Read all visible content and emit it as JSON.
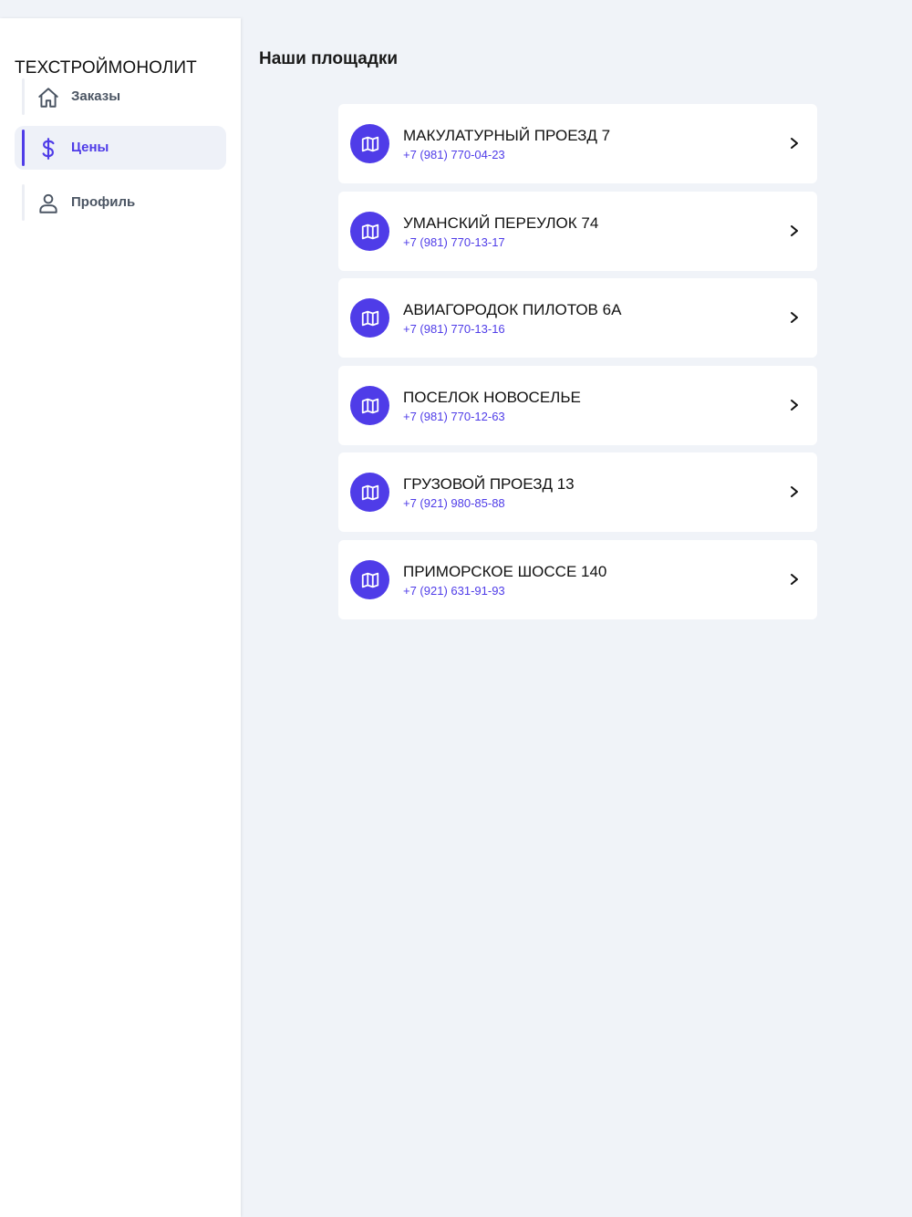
{
  "sidebar": {
    "brand": "ТЕХСТРОЙМОНОЛИТ",
    "items": [
      {
        "label": "Заказы",
        "icon": "home-icon",
        "active": false
      },
      {
        "label": "Цены",
        "icon": "dollar-icon",
        "active": true
      },
      {
        "label": "Профиль",
        "icon": "user-icon",
        "active": false
      }
    ]
  },
  "main": {
    "title": "Наши площадки",
    "sites": [
      {
        "name": "МАКУЛАТУРНЫЙ ПРОЕЗД 7",
        "phone": "+7 (981) 770-04-23"
      },
      {
        "name": "УМАНСКИЙ ПЕРЕУЛОК 74",
        "phone": "+7 (981) 770-13-17"
      },
      {
        "name": "АВИАГОРОДОК ПИЛОТОВ 6А",
        "phone": "+7 (981) 770-13-16"
      },
      {
        "name": "ПОСЕЛОК НОВОСЕЛЬЕ",
        "phone": "+7 (981) 770-12-63"
      },
      {
        "name": "ГРУЗОВОЙ ПРОЕЗД 13",
        "phone": "+7 (921) 980-85-88"
      },
      {
        "name": "ПРИМОРСКОЕ ШОССЕ 140",
        "phone": "+7 (921) 631-91-93"
      }
    ]
  },
  "colors": {
    "accent": "#4f3ce8",
    "background": "#f0f3f8",
    "card": "#ffffff",
    "nav_text": "#4b5563"
  }
}
